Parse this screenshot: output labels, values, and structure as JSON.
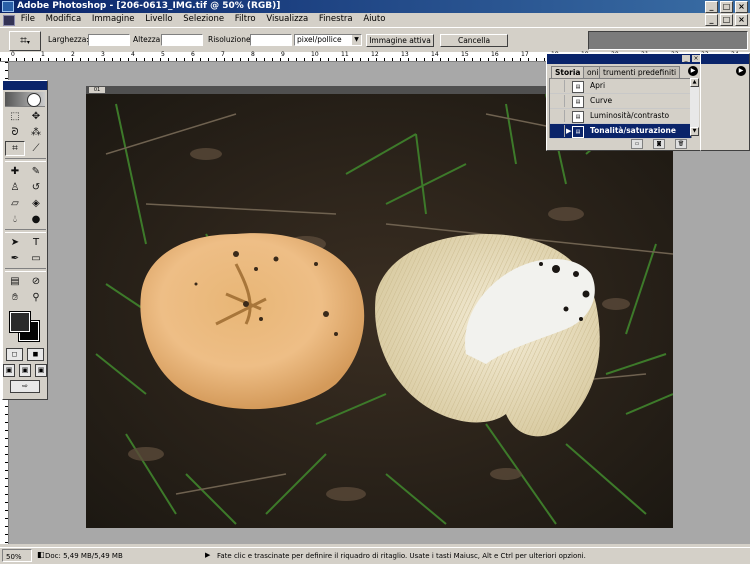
{
  "window": {
    "title": "Adobe Photoshop - [206-0613_IMG.tif @ 50% (RGB)]"
  },
  "menu": {
    "items": [
      "File",
      "Modifica",
      "Immagine",
      "Livello",
      "Selezione",
      "Filtro",
      "Visualizza",
      "Finestra",
      "Aiuto"
    ]
  },
  "options": {
    "larghezza_label": "Larghezza:",
    "altezza_label": "Altezza:",
    "risoluzione_label": "Risoluzione:",
    "unit_selected": "pixel/pollice",
    "immagine_attiva_label": "Immagine attiva",
    "cancella_label": "Cancella",
    "larghezza_value": "",
    "altezza_value": "",
    "risoluzione_value": ""
  },
  "history_palette": {
    "tabs": [
      "Storia",
      "oni",
      "trumenti predefiniti"
    ],
    "items": [
      "Apri",
      "Curve",
      "Luminosità/contrasto",
      "Tonalità/saturazione"
    ],
    "selected_index": 3
  },
  "document": {
    "ruler_marks_h": [
      "0",
      "1",
      "2",
      "3",
      "4",
      "5",
      "6",
      "7",
      "8",
      "9",
      "10",
      "11",
      "12",
      "13",
      "14",
      "15",
      "16",
      "17",
      "18",
      "19",
      "20",
      "21",
      "22",
      "23",
      "24"
    ]
  },
  "statusbar": {
    "zoom": "50%",
    "doc_size": "Doc: 5,49 MB/5,49 MB",
    "hint": "Fate clic e trascinate per definire il riquadro di ritaglio. Usate i tasti Maiusc, Alt e Ctrl per ulteriori opzioni."
  },
  "icons": {
    "crop": "crop-icon",
    "marquee": "marquee-icon",
    "move": "move-icon",
    "lasso": "lasso-icon",
    "magic_wand": "magic-wand-icon",
    "brush": "brush-icon",
    "type": "type-icon",
    "hand": "hand-icon",
    "zoom": "zoom-icon"
  }
}
